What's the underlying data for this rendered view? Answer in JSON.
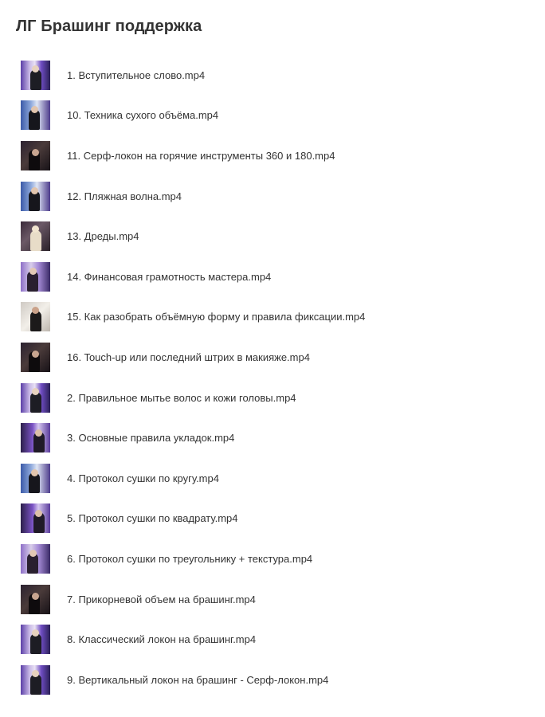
{
  "folder": {
    "title": "ЛГ Брашинг поддержка"
  },
  "files": [
    {
      "name": "1. Вступительное слово.mp4",
      "thumb": "stage"
    },
    {
      "name": "10. Техника сухого объёма.mp4",
      "thumb": "blue"
    },
    {
      "name": "11. Серф-локон на горячие инструменты 360 и 180.mp4",
      "thumb": "dark"
    },
    {
      "name": "12. Пляжная волна.mp4",
      "thumb": "blue"
    },
    {
      "name": "13. Дреды.mp4",
      "thumb": "blonde"
    },
    {
      "name": "14. Финансовая грамотность мастера.mp4",
      "thumb": "purple"
    },
    {
      "name": "15. Как разобрать объёмную форму и правила фиксации.mp4",
      "thumb": "grey"
    },
    {
      "name": "16. Touch-up или последний штрих в макияже.mp4",
      "thumb": "dark"
    },
    {
      "name": "2. Правильное мытье волос и кожи головы.mp4",
      "thumb": "stage"
    },
    {
      "name": "3. Основные правила укладок.mp4",
      "thumb": "violet"
    },
    {
      "name": "4. Протокол сушки по кругу.mp4",
      "thumb": "blue"
    },
    {
      "name": "5. Протокол сушки по квадрату.mp4",
      "thumb": "violet"
    },
    {
      "name": "6. Протокол сушки по треугольнику + текстура.mp4",
      "thumb": "purple"
    },
    {
      "name": "7. Прикорневой объем на брашинг.mp4",
      "thumb": "dark"
    },
    {
      "name": "8. Классический локон на брашинг.mp4",
      "thumb": "stage"
    },
    {
      "name": "9. Вертикальный локон на брашинг - Серф-локон.mp4",
      "thumb": "stage"
    }
  ]
}
